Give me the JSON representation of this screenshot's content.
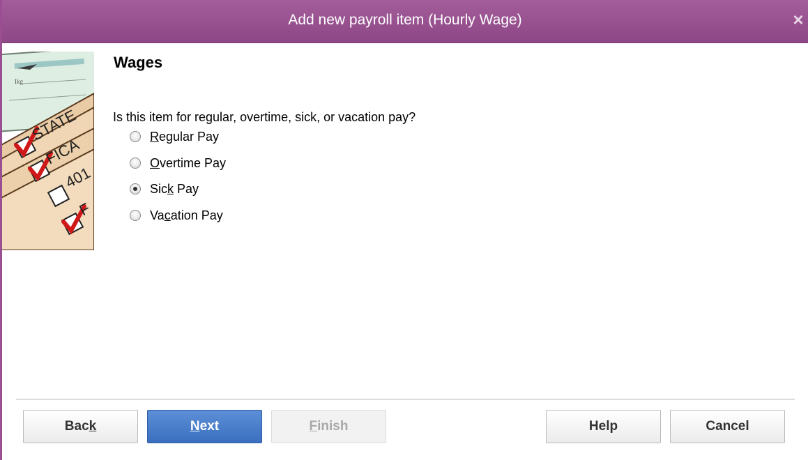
{
  "window": {
    "title": "Add new payroll item (Hourly Wage)",
    "close_label": "×"
  },
  "illustration": {
    "check_text": "Ikg",
    "labels": [
      "STATE",
      "FICA",
      "401",
      "F"
    ]
  },
  "main": {
    "heading": "Wages",
    "question": "Is this item for regular, overtime, sick, or vacation pay?",
    "options": [
      {
        "pre": "",
        "ul": "R",
        "post": "egular Pay",
        "checked": false
      },
      {
        "pre": "",
        "ul": "O",
        "post": "vertime Pay",
        "checked": false
      },
      {
        "pre": "Sic",
        "ul": "k",
        "post": " Pay",
        "checked": true
      },
      {
        "pre": "Va",
        "ul": "c",
        "post": "ation Pay",
        "checked": false
      }
    ]
  },
  "buttons": {
    "back": {
      "pre": "Bac",
      "ul": "k",
      "post": ""
    },
    "next": {
      "pre": "",
      "ul": "N",
      "post": "ext"
    },
    "finish": {
      "pre": "",
      "ul": "F",
      "post": "inish",
      "disabled": true
    },
    "help": {
      "pre": "Help",
      "ul": "",
      "post": ""
    },
    "cancel": {
      "pre": "Cancel",
      "ul": "",
      "post": ""
    }
  },
  "colors": {
    "titlebar": "#9b4f93",
    "primary_button": "#3a6fc0",
    "check_mark": "#d01818"
  }
}
